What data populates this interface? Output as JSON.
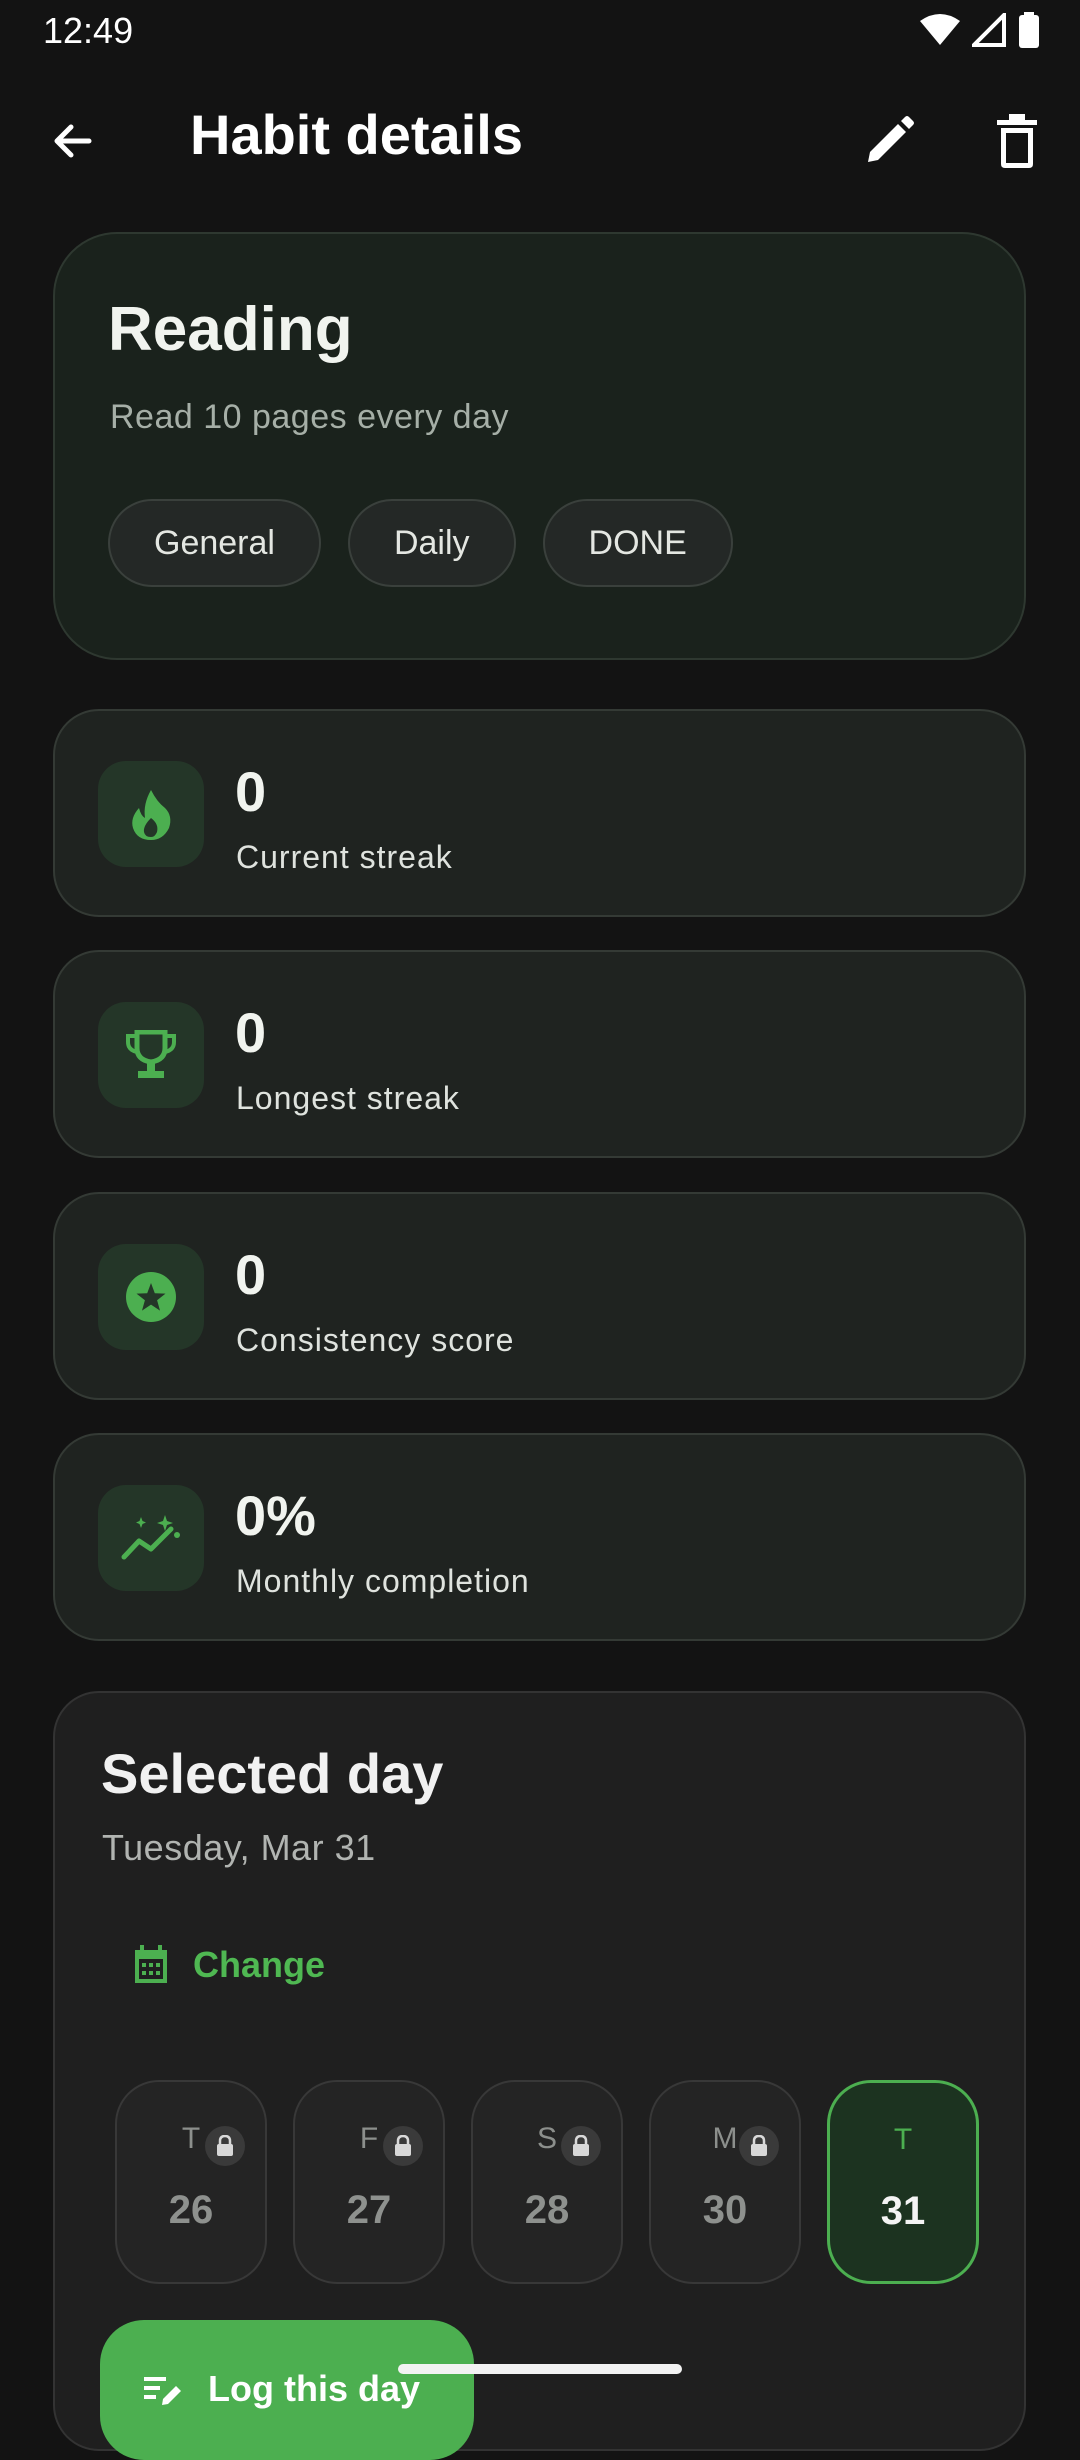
{
  "status_bar": {
    "time": "12:49"
  },
  "app_bar": {
    "title": "Habit details"
  },
  "habit": {
    "name": "Reading",
    "description": "Read 10 pages every day",
    "chips": [
      "General",
      "Daily",
      "DONE"
    ]
  },
  "stats": [
    {
      "value": "0",
      "label": "Current streak",
      "icon": "flame-icon"
    },
    {
      "value": "0",
      "label": "Longest streak",
      "icon": "trophy-icon"
    },
    {
      "value": "0",
      "label": "Consistency score",
      "icon": "star-icon"
    },
    {
      "value": "0%",
      "label": "Monthly completion",
      "icon": "trend-icon"
    }
  ],
  "selected_day": {
    "title": "Selected day",
    "date": "Tuesday, Mar 31",
    "change_label": "Change",
    "days": [
      {
        "letter": "T",
        "num": "26",
        "locked": true
      },
      {
        "letter": "F",
        "num": "27",
        "locked": true
      },
      {
        "letter": "S",
        "num": "28",
        "locked": true
      },
      {
        "letter": "M",
        "num": "30",
        "locked": true
      },
      {
        "letter": "T",
        "num": "31",
        "locked": false,
        "selected": true
      }
    ],
    "log_label": "Log this day"
  },
  "colors": {
    "accent": "#4caf50",
    "background": "#131313"
  }
}
